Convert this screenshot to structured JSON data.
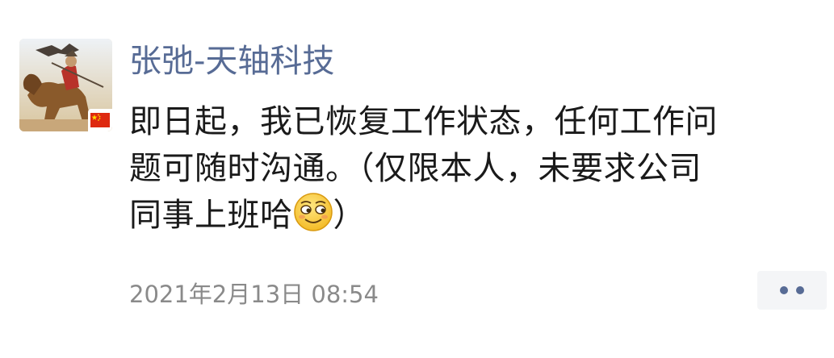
{
  "post": {
    "author_name": "张弛-天轴科技",
    "content_lines": [
      "即日起，我已恢复工作状态，任何工作问",
      "题可随时沟通。（仅限本人，未要求公司",
      "同事上班哈"
    ],
    "content_tail": "）",
    "emoji_icon": "grinning-squint-emoji",
    "timestamp": "2021年2月13日 08:54",
    "avatar_icon": "avatar-eagle-rider-image",
    "badge_icon": "china-flag-icon",
    "more_icon": "more-dots-icon"
  },
  "colors": {
    "author": "#576b95",
    "text": "#1a1a1a",
    "timestamp": "#8a8a8a",
    "more_bg": "#f4f5f7"
  }
}
